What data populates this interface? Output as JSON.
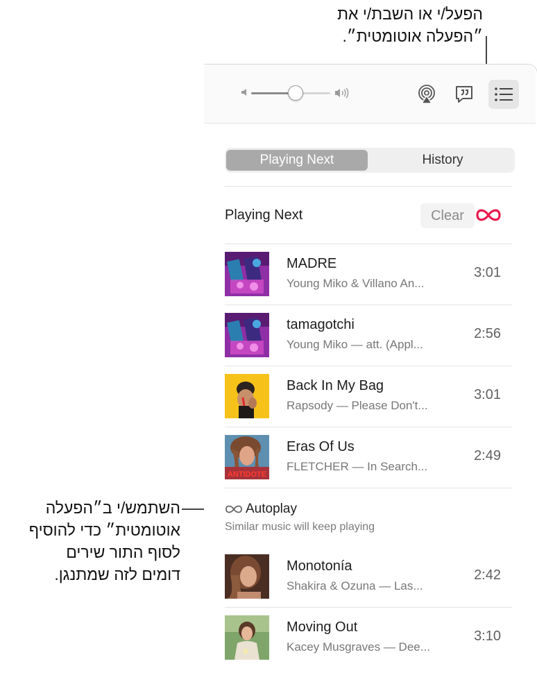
{
  "annotations": {
    "top_lines": [
      "הפעל/י או השבת/י את",
      "״הפעלה אוטומטית״."
    ],
    "left_lines": [
      "השתמש/י ב״הפעלה",
      "אוטומטית״ כדי להוסיף",
      "לסוף התור שירים",
      "דומים לזה שמתנגן."
    ]
  },
  "toolbar": {
    "volume_level": 0.55,
    "icons": [
      "volume-low-icon",
      "volume-high-icon",
      "airplay-icon",
      "lyrics-icon",
      "queue-list-icon"
    ]
  },
  "tabs": {
    "playing_next": "Playing Next",
    "history": "History",
    "selected": "playing_next"
  },
  "queue": {
    "title": "Playing Next",
    "clear_label": "Clear",
    "autoplay_on": true,
    "accent_color": "#e8194b"
  },
  "tracks": [
    {
      "title": "MADRE",
      "subtitle": "Young Miko & Villano An...",
      "duration": "3:01"
    },
    {
      "title": "tamagotchi",
      "subtitle": "Young Miko — att. (Appl...",
      "duration": "2:56"
    },
    {
      "title": "Back In My Bag",
      "subtitle": "Rapsody — Please Don't...",
      "duration": "3:01"
    },
    {
      "title": "Eras Of Us",
      "subtitle": "FLETCHER — In Search...",
      "duration": "2:49"
    }
  ],
  "autoplay": {
    "label": "Autoplay",
    "description": "Similar music will keep playing"
  },
  "autoplay_tracks": [
    {
      "title": "Monotonía",
      "subtitle": "Shakira & Ozuna — Las...",
      "duration": "2:42"
    },
    {
      "title": "Moving Out",
      "subtitle": "Kacey Musgraves — Dee...",
      "duration": "3:10"
    }
  ],
  "artwork_text": {
    "eras_of_us": "ANTIDOTE"
  }
}
